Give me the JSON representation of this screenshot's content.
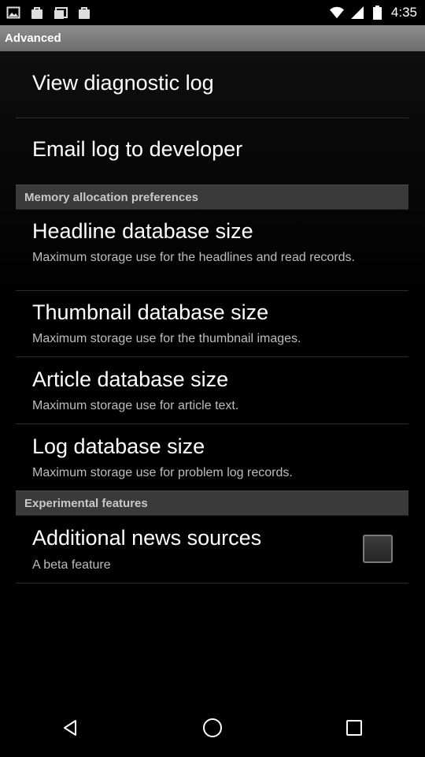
{
  "status_bar": {
    "left_icons": [
      "image-icon",
      "bag-icon",
      "photos-icon",
      "bag-icon"
    ],
    "right_icons": [
      "wifi-icon",
      "signal-icon",
      "battery-icon"
    ],
    "time": "4:35"
  },
  "titlebar": {
    "title": "Advanced"
  },
  "items": {
    "view_log": {
      "title": "View diagnostic log"
    },
    "email_log": {
      "title": "Email log to developer"
    },
    "headline_db": {
      "title": "Headline database size",
      "summary": "Maximum storage use for the headlines and read records."
    },
    "thumbnail_db": {
      "title": "Thumbnail database size",
      "summary": "Maximum storage use for the thumbnail images."
    },
    "article_db": {
      "title": "Article database size",
      "summary": "Maximum storage use for article text."
    },
    "log_db": {
      "title": "Log database size",
      "summary": "Maximum storage use for problem log records."
    },
    "additional_sources": {
      "title": "Additional news sources",
      "summary": "A beta feature",
      "checked": false
    }
  },
  "sections": {
    "memory": "Memory allocation preferences",
    "experimental": "Experimental features"
  },
  "navbar": {
    "icons": [
      "back-icon",
      "home-icon",
      "recents-icon"
    ]
  }
}
